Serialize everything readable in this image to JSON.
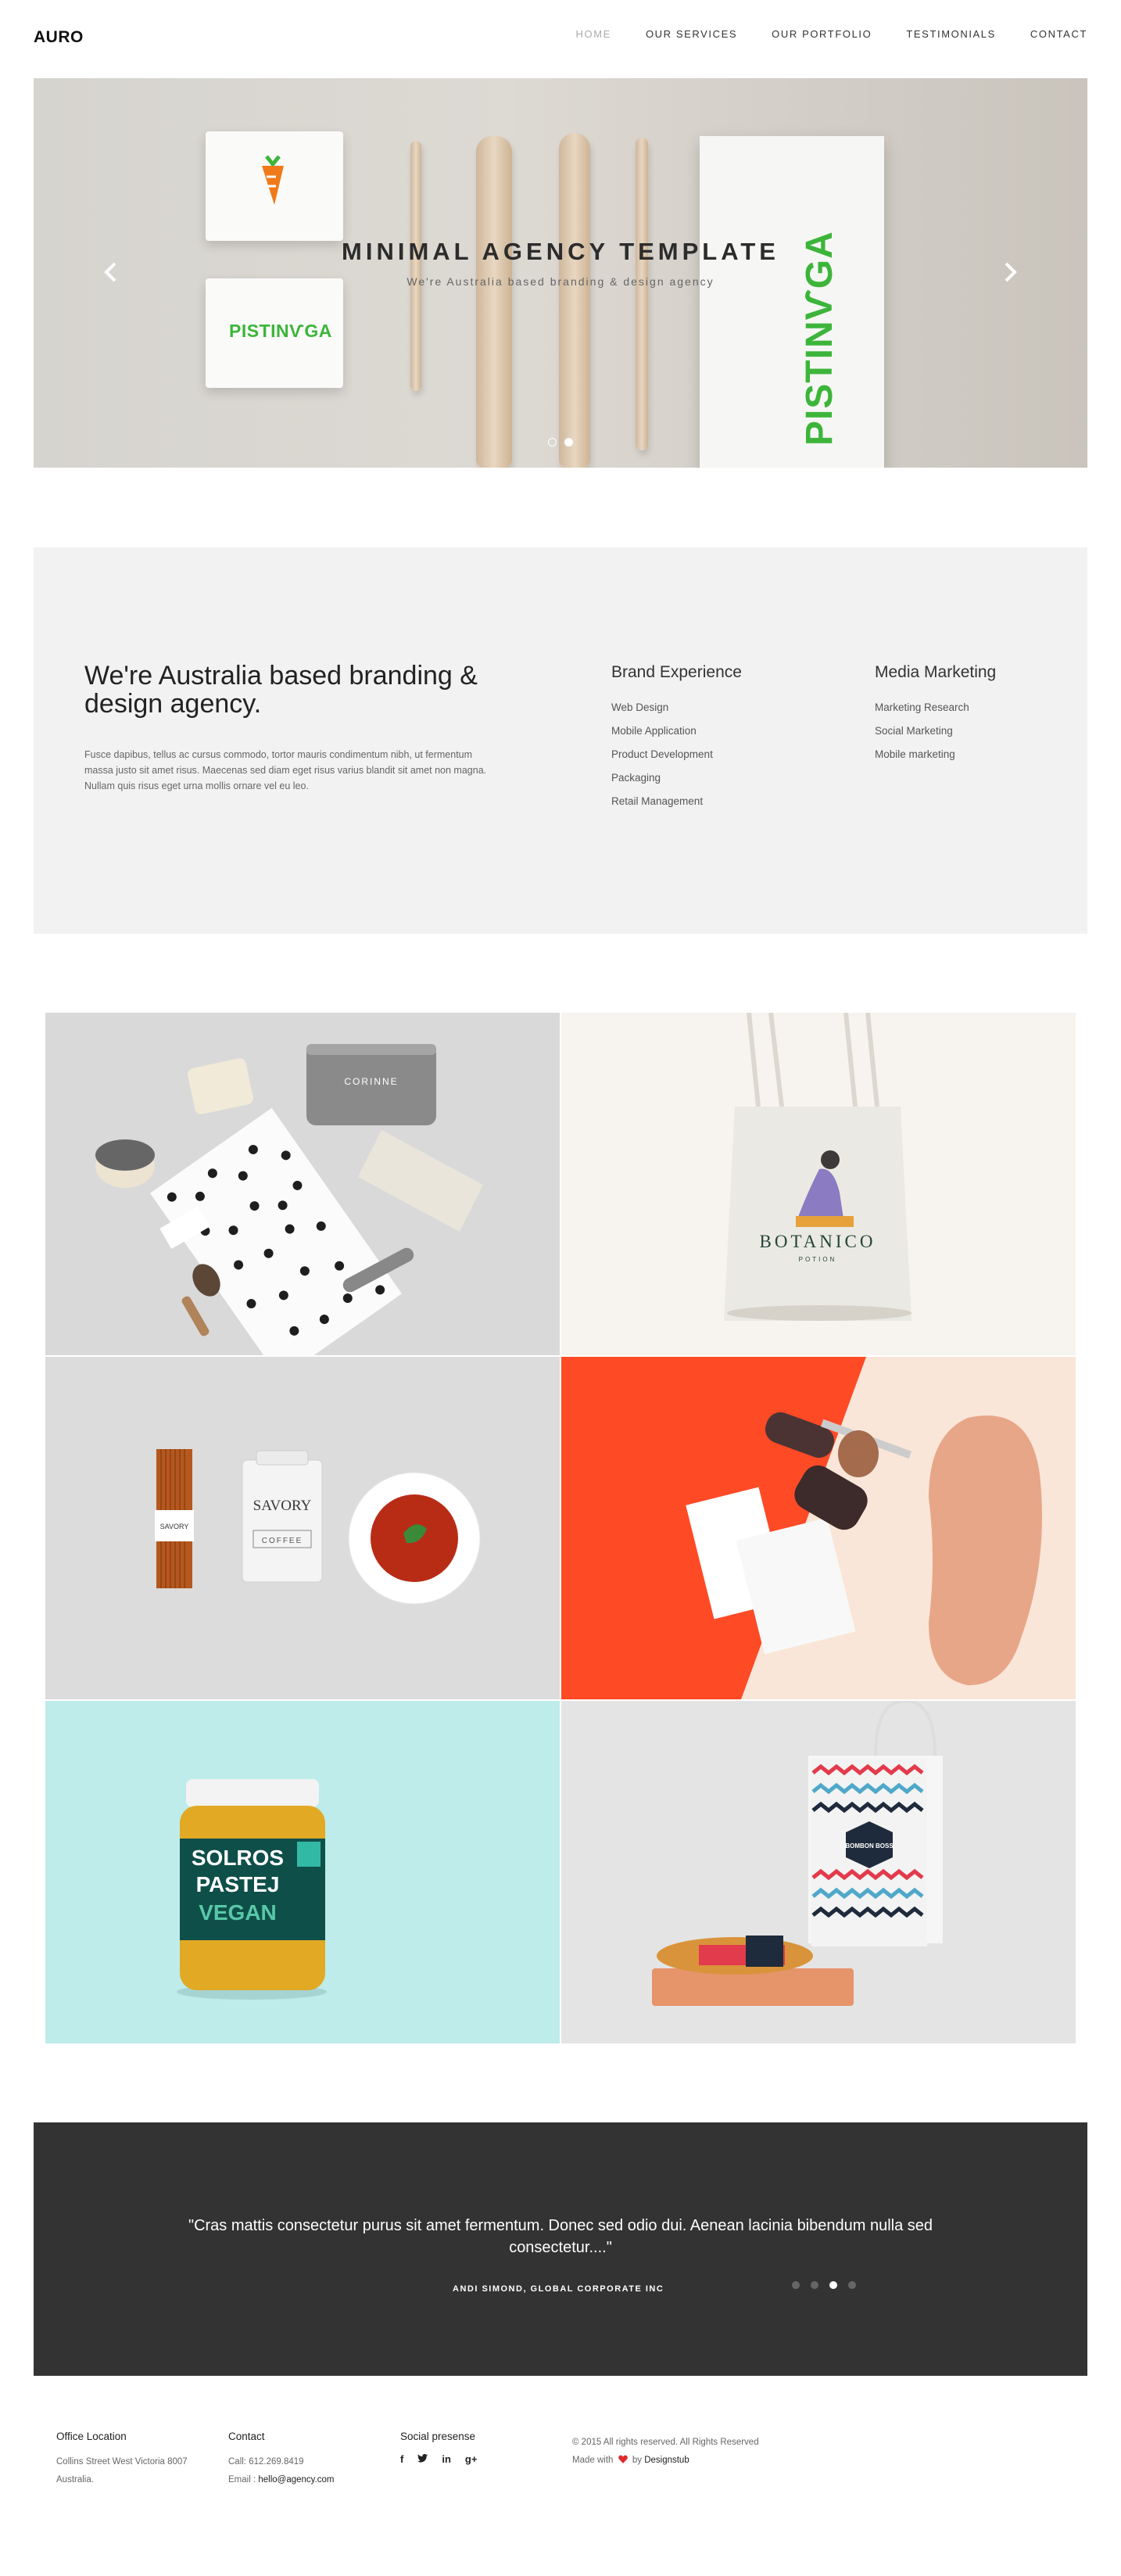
{
  "header": {
    "logo": "AURO",
    "nav": [
      "HOME",
      "OUR SERVICES",
      "OUR PORTFOLIO",
      "TESTIMONIALS",
      "CONTACT"
    ]
  },
  "hero": {
    "title": "MINIMAL AGENCY TEMPLATE",
    "subtitle": "We're Australia based branding & design agency",
    "brand": "PISTINѴGA",
    "slide_count": 2,
    "active_slide": 2,
    "colors": {
      "brand_green": "#3cb53a",
      "carrot_orange": "#f07a1a"
    }
  },
  "about": {
    "title": "We're Australia based branding & design agency.",
    "text": "Fusce dapibus, tellus ac cursus commodo, tortor mauris condimentum nibh, ut fermentum massa justo sit amet risus. Maecenas sed diam eget risus varius blandit sit amet non magna. Nullam quis risus eget urna mollis ornare vel eu leo.",
    "brand_experience": {
      "heading": "Brand Experience",
      "items": [
        "Web Design",
        "Mobile Application",
        "Product Development",
        "Packaging",
        "Retail Management"
      ]
    },
    "media_marketing": {
      "heading": "Media Marketing",
      "items": [
        "Marketing Research",
        "Social Marketing",
        "Mobile marketing"
      ]
    }
  },
  "portfolio": {
    "corinne": "CORINNE",
    "botanico": "BOTANICO",
    "botanico_sub": "POTION",
    "savory": "SAVORY",
    "coffee": "COFFEE",
    "jar_line1": "SOLROS",
    "jar_line2": "PASTEJ",
    "jar_line3": "VEGAN",
    "bombon": "BOMBON BOSS"
  },
  "testimonial": {
    "quote": "\"Cras mattis consectetur purus sit amet fermentum. Donec sed odio dui. Aenean lacinia bibendum nulla sed consectetur....\"",
    "author": "ANDI SIMOND, GLOBAL CORPORATE INC",
    "slide_count": 4,
    "active_slide": 3
  },
  "footer": {
    "office": {
      "heading": "Office Location",
      "line1": "Collins Street West Victoria 8007",
      "line2": "Australia."
    },
    "contact": {
      "heading": "Contact",
      "call": "Call: 612.269.8419",
      "email_label": "Email : ",
      "email": "hello@agency.com"
    },
    "social": {
      "heading": "Social presense",
      "icons": [
        "facebook-icon",
        "twitter-icon",
        "linkedin-icon",
        "google-plus-icon"
      ]
    },
    "copyright": "© 2015 All rights reserved. All Rights Reserved",
    "made_with": "Made with",
    "by": "by",
    "author": "Designstub",
    "heart_color": "#e02b2b"
  }
}
